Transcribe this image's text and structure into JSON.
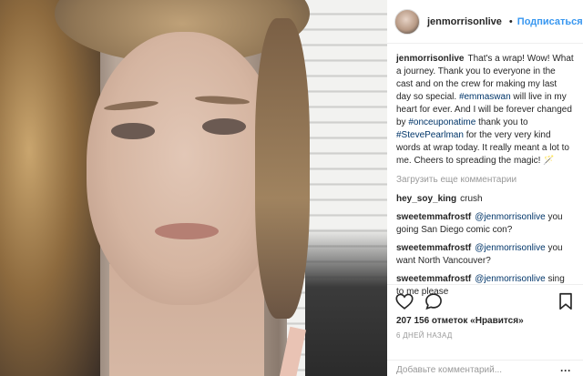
{
  "post": {
    "username": "jenmorrisonlive",
    "header_dot": "•",
    "follow_label": "Подписаться",
    "caption": {
      "username": "jenmorrisonlive",
      "part1": "That's a wrap! Wow! What a journey. Thank you to everyone in the cast and on the crew for making my last day so special.",
      "tag1": "#emmaswan",
      "part2": " will live in my heart for ever. And I will be forever changed by ",
      "tag2": "#onceuponatime",
      "part3": " thank you to ",
      "tag3": "#StevePearlman",
      "part4": " for the very very kind words at wrap today. It really meant a lot to me. Cheers to spreading the magic! 🪄"
    },
    "load_more_label": "Загрузить еще комментарии",
    "comments": [
      {
        "username": "hey_soy_king",
        "mention": "",
        "text": "crush"
      },
      {
        "username": "sweetemmafrostf",
        "mention": "@jenmorrisonlive",
        "text": " you going San Diego comic con?"
      },
      {
        "username": "sweetemmafrostf",
        "mention": "@jenmorrisonlive",
        "text": " you want North Vancouver?"
      },
      {
        "username": "sweetemmafrostf",
        "mention": "@jenmorrisonlive",
        "text": " sing to me please"
      }
    ],
    "likes_text": "207 156 отметок «Нравится»",
    "time_text": "6 дней назад",
    "add_comment_placeholder": "Добавьте комментарий...",
    "more_label": "···"
  },
  "icons": {
    "verified": "verified-badge-icon",
    "like": "heart-icon",
    "comment": "comment-icon",
    "save": "bookmark-icon"
  },
  "colors": {
    "link": "#003569",
    "follow": "#3897f0",
    "muted": "#999999"
  }
}
